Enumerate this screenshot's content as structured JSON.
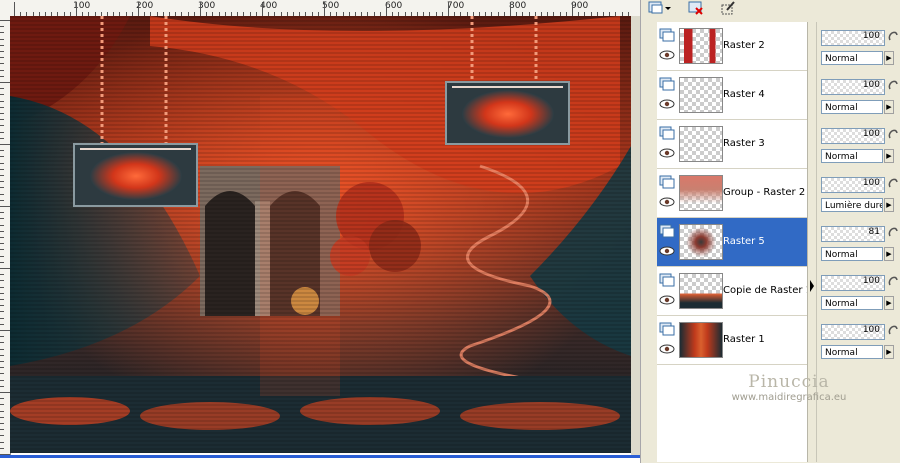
{
  "ruler": {
    "labels": [
      "100",
      "200",
      "300",
      "400",
      "500",
      "600",
      "700",
      "800",
      "900"
    ]
  },
  "artwork": {
    "name": "scene-canvas"
  },
  "toolbar": {
    "icons": [
      "layer-visibility-icon",
      "dropdown-icon",
      "delete-layer-icon",
      "edit-icon"
    ]
  },
  "layers": [
    {
      "name": "Raster 2",
      "opacity": "100",
      "blend": "Normal",
      "selected": false
    },
    {
      "name": "Raster 4",
      "opacity": "100",
      "blend": "Normal",
      "selected": false
    },
    {
      "name": "Raster 3",
      "opacity": "100",
      "blend": "Normal",
      "selected": false
    },
    {
      "name": "Group - Raster 2",
      "opacity": "100",
      "blend": "Lumière dure",
      "selected": false
    },
    {
      "name": "Raster 5",
      "opacity": "81",
      "blend": "Normal",
      "selected": true
    },
    {
      "name": "Copie de Raster 1",
      "opacity": "100",
      "blend": "Normal",
      "selected": false
    },
    {
      "name": "Raster 1",
      "opacity": "100",
      "blend": "Normal",
      "selected": false
    }
  ],
  "watermark": {
    "name": "Pinuccia",
    "url": "www.maidiregrafica.eu"
  },
  "colors": {
    "selection": "#316ac5",
    "accent": "#e0401c"
  }
}
